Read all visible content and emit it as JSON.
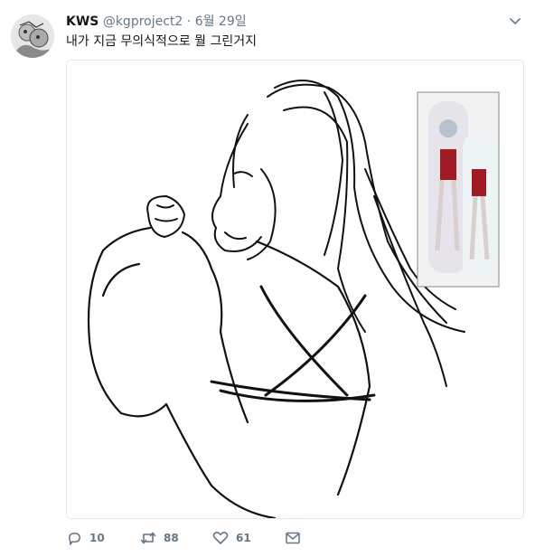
{
  "tweet": {
    "name": "KWS",
    "handle": "@kgproject2",
    "separator": "·",
    "date": "6월 29일",
    "text": "내가 지금 무의식적으로 뭘 그린거지",
    "image_icon": "image",
    "actions": {
      "reply": {
        "icon": "reply-icon",
        "count": "10"
      },
      "retweet": {
        "icon": "retweet-icon",
        "count": "88"
      },
      "like": {
        "icon": "heart-icon",
        "count": "61"
      },
      "dm": {
        "icon": "envelope-icon"
      }
    }
  },
  "colors": {
    "text": "#14171a",
    "secondary": "#657786",
    "border": "#e1e8ed",
    "background": "#ffffff"
  }
}
